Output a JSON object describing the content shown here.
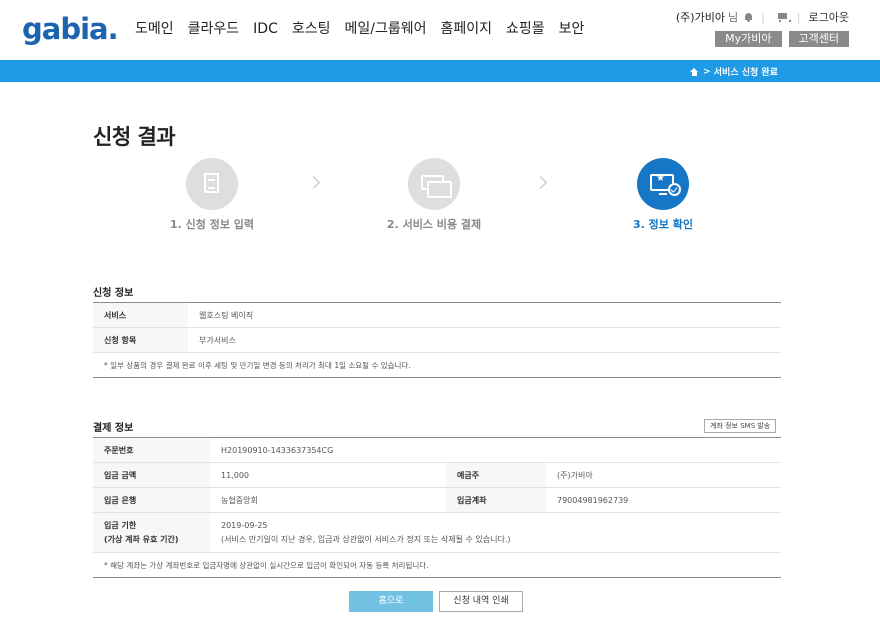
{
  "header": {
    "logo": "gabia.",
    "gnb": [
      "도메인",
      "클라우드",
      "IDC",
      "호스팅",
      "메일/그룹웨어",
      "홈페이지",
      "쇼핑몰",
      "보안"
    ],
    "user_name": "(주)가비아",
    "user_suffix": "님",
    "logout": "로그아웃",
    "my_gabia": "My가비아",
    "customer_center": "고객센터"
  },
  "breadcrumb": "서비스 신청 완료",
  "page_title": "신청 결과",
  "steps": [
    {
      "label": "1. 신청 정보 입력",
      "active": false,
      "icon": "document-icon"
    },
    {
      "label": "2. 서비스 비용 결제",
      "active": false,
      "icon": "cards-icon"
    },
    {
      "label": "3. 정보 확인",
      "active": true,
      "icon": "monitor-check-icon"
    }
  ],
  "apply_info": {
    "title": "신청 정보",
    "rows": [
      {
        "label": "서비스",
        "value": "웹호스팅 베이직"
      },
      {
        "label": "신청 항목",
        "value": "부가서비스"
      }
    ],
    "note": "* 일부 상품의 경우 결제 완료 이후 세팅 및 만기일 변경 등의 처리가 최대 1일 소요될 수 있습니다."
  },
  "payment_info": {
    "title": "결제 정보",
    "sms_button": "계좌 정보 SMS 발송",
    "order_no_label": "주문번호",
    "order_no": "H20190910-1433637354CG",
    "amount_label": "입금 금액",
    "amount": "11,000",
    "depositor_label": "예금주",
    "depositor": "(주)가비아",
    "bank_label": "입금 은행",
    "bank": "농협중앙회",
    "account_label": "입금계좌",
    "account": "79004981962739",
    "deadline_label_1": "입금 기한",
    "deadline_label_2": "(가상 계좌 유효 기간)",
    "deadline": "2019-09-25",
    "deadline_note": "(서비스 만기일이 지난 경우, 입금과 상관없이 서비스가 정지 또는 삭제될 수 있습니다.)",
    "note": "* 해당 계좌는 가상 계좌번호로 입금자명에 상관없이 실시간으로 입금이 확인되어 자동 등록 처리됩니다."
  },
  "buttons": {
    "home": "홈으로",
    "print": "신청 내역 인쇄"
  },
  "colors": {
    "brand": "#1c63b0",
    "bar": "#1e9be6",
    "active_step": "#1577c5",
    "home_button": "#72c1e3"
  }
}
